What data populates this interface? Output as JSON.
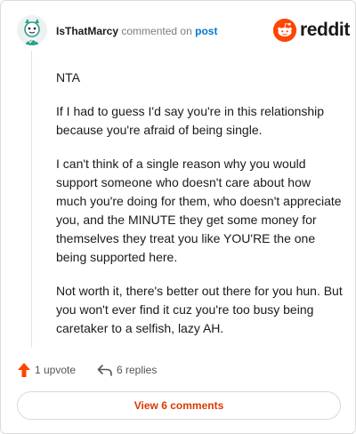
{
  "header": {
    "username": "IsThatMarcy",
    "verb": "commented on",
    "post_link": "post",
    "brand": "reddit"
  },
  "comment": {
    "paragraphs": [
      "NTA",
      "If I had to guess I'd say you're in this relationship because you're afraid of being single.",
      "I can't think of a single reason why you would support someone who doesn't care about how much you're doing for them, who doesn't appreciate you, and the MINUTE they get some money for themselves they treat you like YOU'RE the one being supported here.",
      "Not worth it, there's better out there for you hun. But you won't ever find it cuz you're too busy being caretaker to a selfish, lazy AH."
    ]
  },
  "actions": {
    "upvote_label": "1 upvote",
    "replies_label": "6 replies"
  },
  "footer": {
    "view_comments_label": "View 6 comments"
  },
  "colors": {
    "brand_orange": "#ff4500",
    "link_blue": "#0079d3",
    "button_text": "#d93a00"
  },
  "icons": {
    "avatar": "avatar-icon",
    "brand": "reddit-logo-icon",
    "upvote": "upvote-arrow-icon",
    "reply": "reply-arrow-icon"
  }
}
